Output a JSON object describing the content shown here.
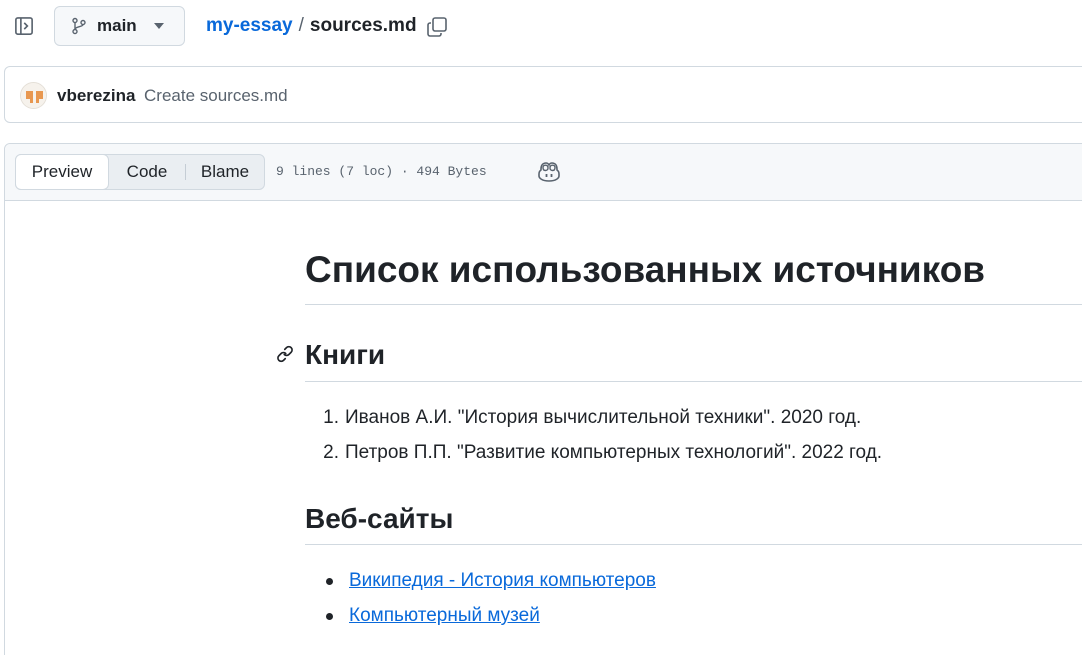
{
  "topbar": {
    "branch": "main",
    "repo": "my-essay",
    "separator": "/",
    "file": "sources.md"
  },
  "commit": {
    "user": "vberezina",
    "message": "Create sources.md"
  },
  "file_header": {
    "tabs": {
      "preview": "Preview",
      "code": "Code",
      "blame": "Blame"
    },
    "meta": "9 lines (7 loc) · 494 Bytes"
  },
  "markdown": {
    "title": "Список использованных источников",
    "books": {
      "heading": "Книги",
      "items": [
        {
          "num": "1.",
          "text": "Иванов А.И. \"История вычислительной техники\". 2020 год."
        },
        {
          "num": "2.",
          "text": "Петров П.П. \"Развитие компьютерных технологий\". 2022 год."
        }
      ]
    },
    "websites": {
      "heading": "Веб-сайты",
      "items": [
        {
          "text": "Википедия - История компьютеров"
        },
        {
          "text": "Компьютерный музей"
        }
      ]
    }
  },
  "colors": {
    "link": "#0969da",
    "text": "#1f2328",
    "muted": "#59636e",
    "border": "#d1d9e0",
    "header_bg": "#f6f8fa"
  },
  "icons": [
    "sidebar-toggle-icon",
    "git-branch-icon",
    "chevron-down-icon",
    "copy-icon",
    "avatar",
    "copilot-icon",
    "link-icon"
  ]
}
